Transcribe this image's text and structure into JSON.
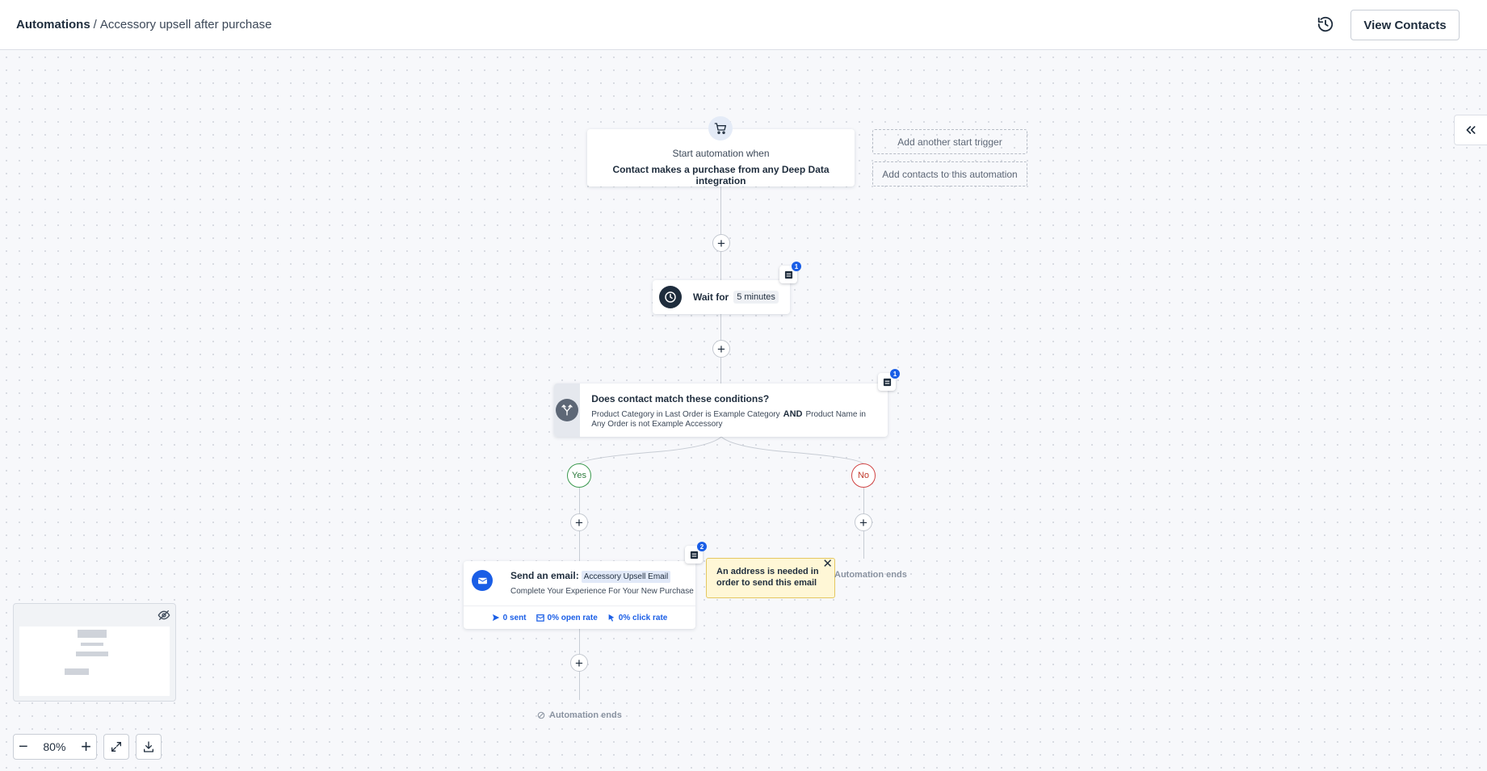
{
  "header": {
    "breadcrumb_root": "Automations",
    "breadcrumb_separator": "/",
    "breadcrumb_current": "Accessory upsell after purchase",
    "view_contacts_label": "View Contacts",
    "history_icon": "history-icon"
  },
  "trigger": {
    "icon": "cart-icon",
    "line1": "Start automation when",
    "line2": "Contact makes a purchase from any Deep Data integration",
    "add_trigger_label": "Add another start trigger",
    "add_contacts_label": "Add contacts to this automation"
  },
  "wait_step": {
    "label": "Wait for",
    "duration": "5 minutes",
    "note_count": "1"
  },
  "condition_step": {
    "title": "Does contact match these conditions?",
    "condition_a": "Product Category in Last Order is Example Category",
    "joiner": "AND",
    "condition_b": "Product Name in Any Order is not Example Accessory",
    "note_count": "1",
    "yes_label": "Yes",
    "no_label": "No"
  },
  "email_step": {
    "title": "Send an email:",
    "email_name": "Accessory Upsell Email",
    "subject": "Complete Your Experience For Your New Purchase",
    "sent": "0 sent",
    "open_rate": "0% open rate",
    "click_rate": "0% click rate",
    "note_count": "2"
  },
  "warning": {
    "text": "An address is needed in order to send this email",
    "close": "✕"
  },
  "ends": {
    "no_branch": "Automation ends",
    "yes_branch": "Automation ends"
  },
  "controls": {
    "zoom_level": "80%",
    "zoom_out": "−",
    "zoom_in": "+"
  },
  "colors": {
    "accent": "#1a5ee6",
    "yes": "#3c9a4f",
    "no": "#d14444",
    "warning_bg": "#fff7d6"
  }
}
